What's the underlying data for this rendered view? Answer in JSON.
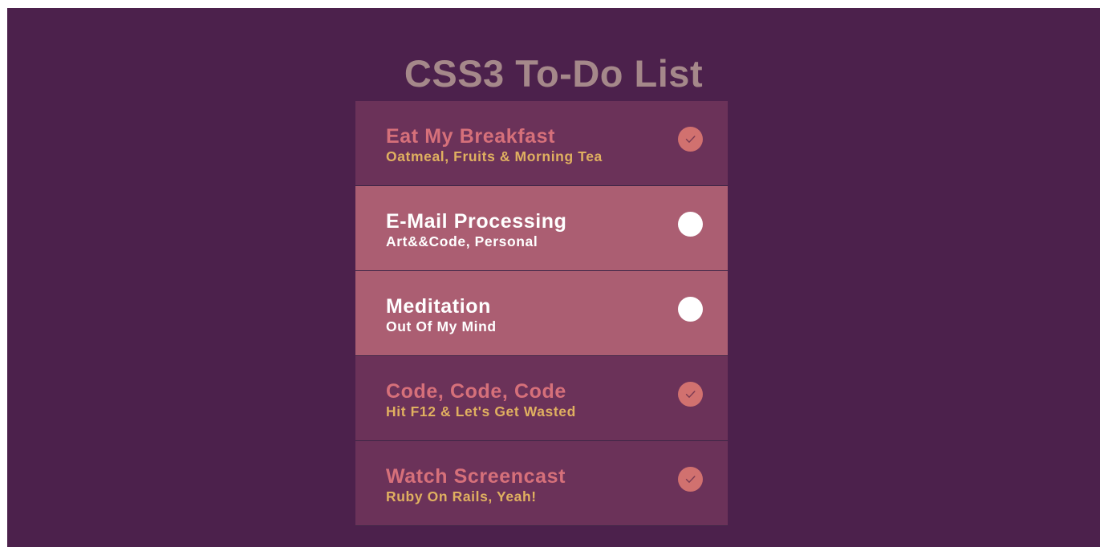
{
  "page": {
    "title": "CSS3 To-Do List"
  },
  "colors": {
    "background": "#4c214c",
    "title": "#a5888a",
    "done_item_bg": "#6b3259",
    "open_item_bg": "#ab5e72",
    "done_title": "#d6707a",
    "done_subtitle": "#e0b060",
    "done_check": "#d1716f",
    "open_text": "#ffffff"
  },
  "todos": [
    {
      "title": "Eat My Breakfast",
      "subtitle": "Oatmeal, Fruits & Morning Tea",
      "done": true,
      "icon": "check-circle-icon"
    },
    {
      "title": "E-Mail Processing",
      "subtitle": "Art&&Code, Personal",
      "done": false,
      "icon": "empty-circle-icon"
    },
    {
      "title": "Meditation",
      "subtitle": "Out Of My Mind",
      "done": false,
      "icon": "empty-circle-icon"
    },
    {
      "title": "Code, Code, Code",
      "subtitle": "Hit F12 & Let's Get Wasted",
      "done": true,
      "icon": "check-circle-icon"
    },
    {
      "title": "Watch Screencast",
      "subtitle": "Ruby On Rails, Yeah!",
      "done": true,
      "icon": "check-circle-icon"
    }
  ]
}
